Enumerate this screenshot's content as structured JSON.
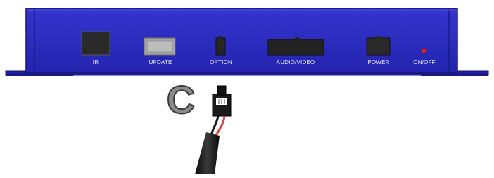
{
  "device": {
    "body_color": "#2b2bc2",
    "port_labels": {
      "ir": "IR",
      "update": "UPDATE",
      "option": "OPTION",
      "audio_video": "AUDIO/VIDEO",
      "power": "POWER",
      "on_off": "ON/OFF"
    },
    "led_color": "#e02020"
  },
  "callout": {
    "letter": "C"
  },
  "cable": {
    "wire_colors": [
      "#111111",
      "#e04040"
    ]
  }
}
